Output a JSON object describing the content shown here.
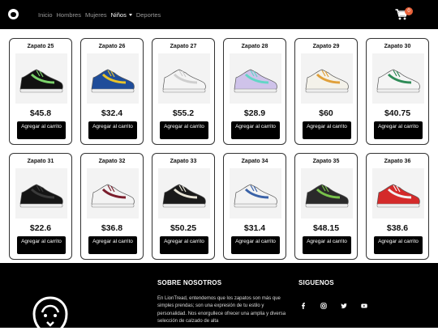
{
  "nav": {
    "links": [
      "Inicio",
      "Hombres",
      "Mujeres",
      "Niños",
      "Deportes"
    ],
    "active_index": 3,
    "cart_count": "0"
  },
  "products": [
    {
      "name": "Zapato 25",
      "price": "$45.8",
      "button": "Agregar al carrito",
      "colors": [
        "#111111",
        "#7bd36a"
      ]
    },
    {
      "name": "Zapato 26",
      "price": "$32.4",
      "button": "Agregar al carrito",
      "colors": [
        "#1f4d9a",
        "#e8c32a"
      ]
    },
    {
      "name": "Zapato 27",
      "price": "$55.2",
      "button": "Agregar al carrito",
      "colors": [
        "#f4f4f4",
        "#cfcfcf"
      ]
    },
    {
      "name": "Zapato 28",
      "price": "$28.9",
      "button": "Agregar al carrito",
      "colors": [
        "#cfc3ea",
        "#63d6c6"
      ]
    },
    {
      "name": "Zapato 29",
      "price": "$60",
      "button": "Agregar al carrito",
      "colors": [
        "#f4f2ea",
        "#e0a03a"
      ]
    },
    {
      "name": "Zapato 30",
      "price": "$40.75",
      "button": "Agregar al carrito",
      "colors": [
        "#f5f5f5",
        "#2e8b57"
      ]
    },
    {
      "name": "Zapato 31",
      "price": "$22.6",
      "button": "Agregar al carrito",
      "colors": [
        "#151515",
        "#3a3a3a"
      ]
    },
    {
      "name": "Zapato 32",
      "price": "$36.8",
      "button": "Agregar al carrito",
      "colors": [
        "#f3f3f3",
        "#7a1d2c"
      ]
    },
    {
      "name": "Zapato 33",
      "price": "$50.25",
      "button": "Agregar al carrito",
      "colors": [
        "#1a1a1a",
        "#e8e4d6"
      ]
    },
    {
      "name": "Zapato 34",
      "price": "$31.4",
      "button": "Agregar al carrito",
      "colors": [
        "#f3f3f3",
        "#3a62a8"
      ]
    },
    {
      "name": "Zapato 35",
      "price": "$48.15",
      "button": "Agregar al carrito",
      "colors": [
        "#2a2a2a",
        "#78c24a"
      ]
    },
    {
      "name": "Zapato 36",
      "price": "$38.6",
      "button": "Agregar al carrito",
      "colors": [
        "#d42a2a",
        "#f3f3f3"
      ]
    }
  ],
  "footer": {
    "about_title": "SOBRE NOSOTROS",
    "about_text": "En LionTread, entendemos que los zapatos son más que simples prendas; son una expresión de tu estilo y personalidad. Nos enorgullece ofrecer una amplia y diversa selección de calzado de alta",
    "follow_title": "SIGUENOS",
    "social_icons": [
      "facebook-icon",
      "instagram-icon",
      "twitter-icon",
      "youtube-icon"
    ]
  }
}
